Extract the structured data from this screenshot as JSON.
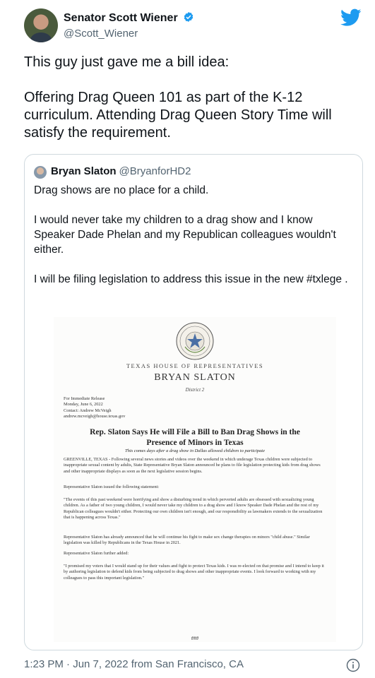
{
  "tweet": {
    "author_name": "Senator Scott Wiener",
    "author_handle": "@Scott_Wiener",
    "text": "This guy just gave me a bill idea:\n\nOffering Drag Queen 101 as part of the K-12 curriculum. Attending Drag Queen Story Time will satisfy the requirement.",
    "timestamp": "1:23 PM · Jun 7, 2022 from San Francisco, CA"
  },
  "quoted_tweet": {
    "author_name": "Bryan Slaton",
    "author_handle": "@BryanforHD2",
    "text": "Drag shows are no place for a child.\n\nI would never take my children to a drag show and I know Speaker Dade Phelan and my Republican colleagues wouldn't either.\n\nI will be filing legislation to address this issue in the new #txlege ."
  },
  "press_release": {
    "house": "TEXAS HOUSE OF REPRESENTATIVES",
    "representative": "BRYAN SLATON",
    "district": "District 2",
    "meta": "For Immediate Release\nMonday, June 6, 2022\nContact: Andrew McVeigh\nandrew.mcveigh@house.texas.gov",
    "headline": "Rep. Slaton Says He will File a Bill to Ban Drag Shows in the\nPresence of Minors in Texas",
    "subhead": "This comes days after a drag show in Dallas allowed children to participate",
    "p1": "GREENVILLE, TEXAS - Following several news stories and videos over the weekend in which underage Texas children were subjected to inappropriate sexual content by adults, State Representative Bryan Slaton announced he plans to file legislation protecting kids from drag shows and other inappropriate displays as soon as the next legislative session begins.",
    "p2": "Representative Slaton issued the following statement:",
    "p3": "\"The events of this past weekend were horrifying and show a disturbing trend in which perverted adults are obsessed with sexualizing young children. As a father of two young children, I would never take my children to a drag show and I know Speaker Dade Phelan and the rest of my Republican colleagues wouldn't either. Protecting our own children isn't enough, and our responsibility as lawmakers extends to the sexualization that is happening across Texas.\"",
    "p4": "Representative Slaton has already announced that he will continue his fight to make sex change therapies on minors \"child abuse.\" Similar legislation was killed by Republicans in the Texas House in 2021.",
    "p5": "Representative Slaton further added:",
    "p6": "\"I promised my voters that I would stand up for their values and fight to protect Texas kids. I was re-elected on that promise and I intend to keep it by authoring legislation to defend kids from being subjected to drag shows and other inappropriate events. I look forward to working with my colleagues to pass this important legislation.\"",
    "end": "###"
  },
  "icons": {
    "brand": "twitter-bird-icon",
    "verified": "verified-badge-icon",
    "info": "info-icon",
    "seal": "texas-seal-icon"
  },
  "colors": {
    "brand_blue": "#1d9bf0",
    "secondary_text": "#536471",
    "border": "#cfd9de"
  }
}
